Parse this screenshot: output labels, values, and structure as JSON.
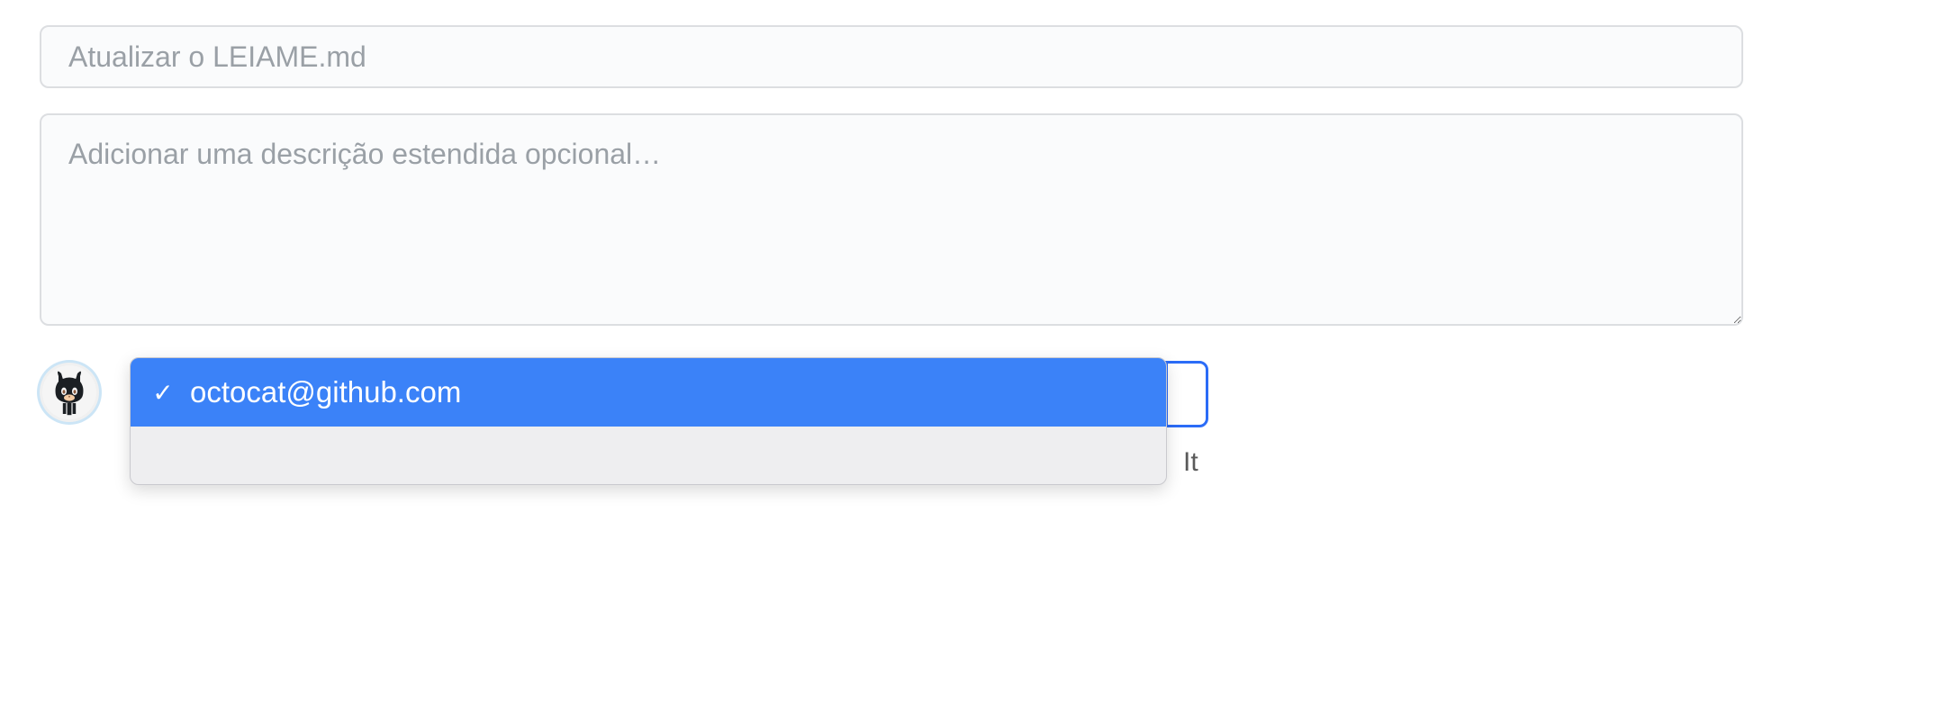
{
  "commit": {
    "summary_placeholder": "Atualizar o LEIAME.md",
    "description_placeholder": "Adicionar uma descrição estendida opcional…"
  },
  "author_dropdown": {
    "options": [
      {
        "label": "octocat@github.com",
        "selected": true
      }
    ]
  },
  "behind": {
    "partial_text": "It"
  }
}
